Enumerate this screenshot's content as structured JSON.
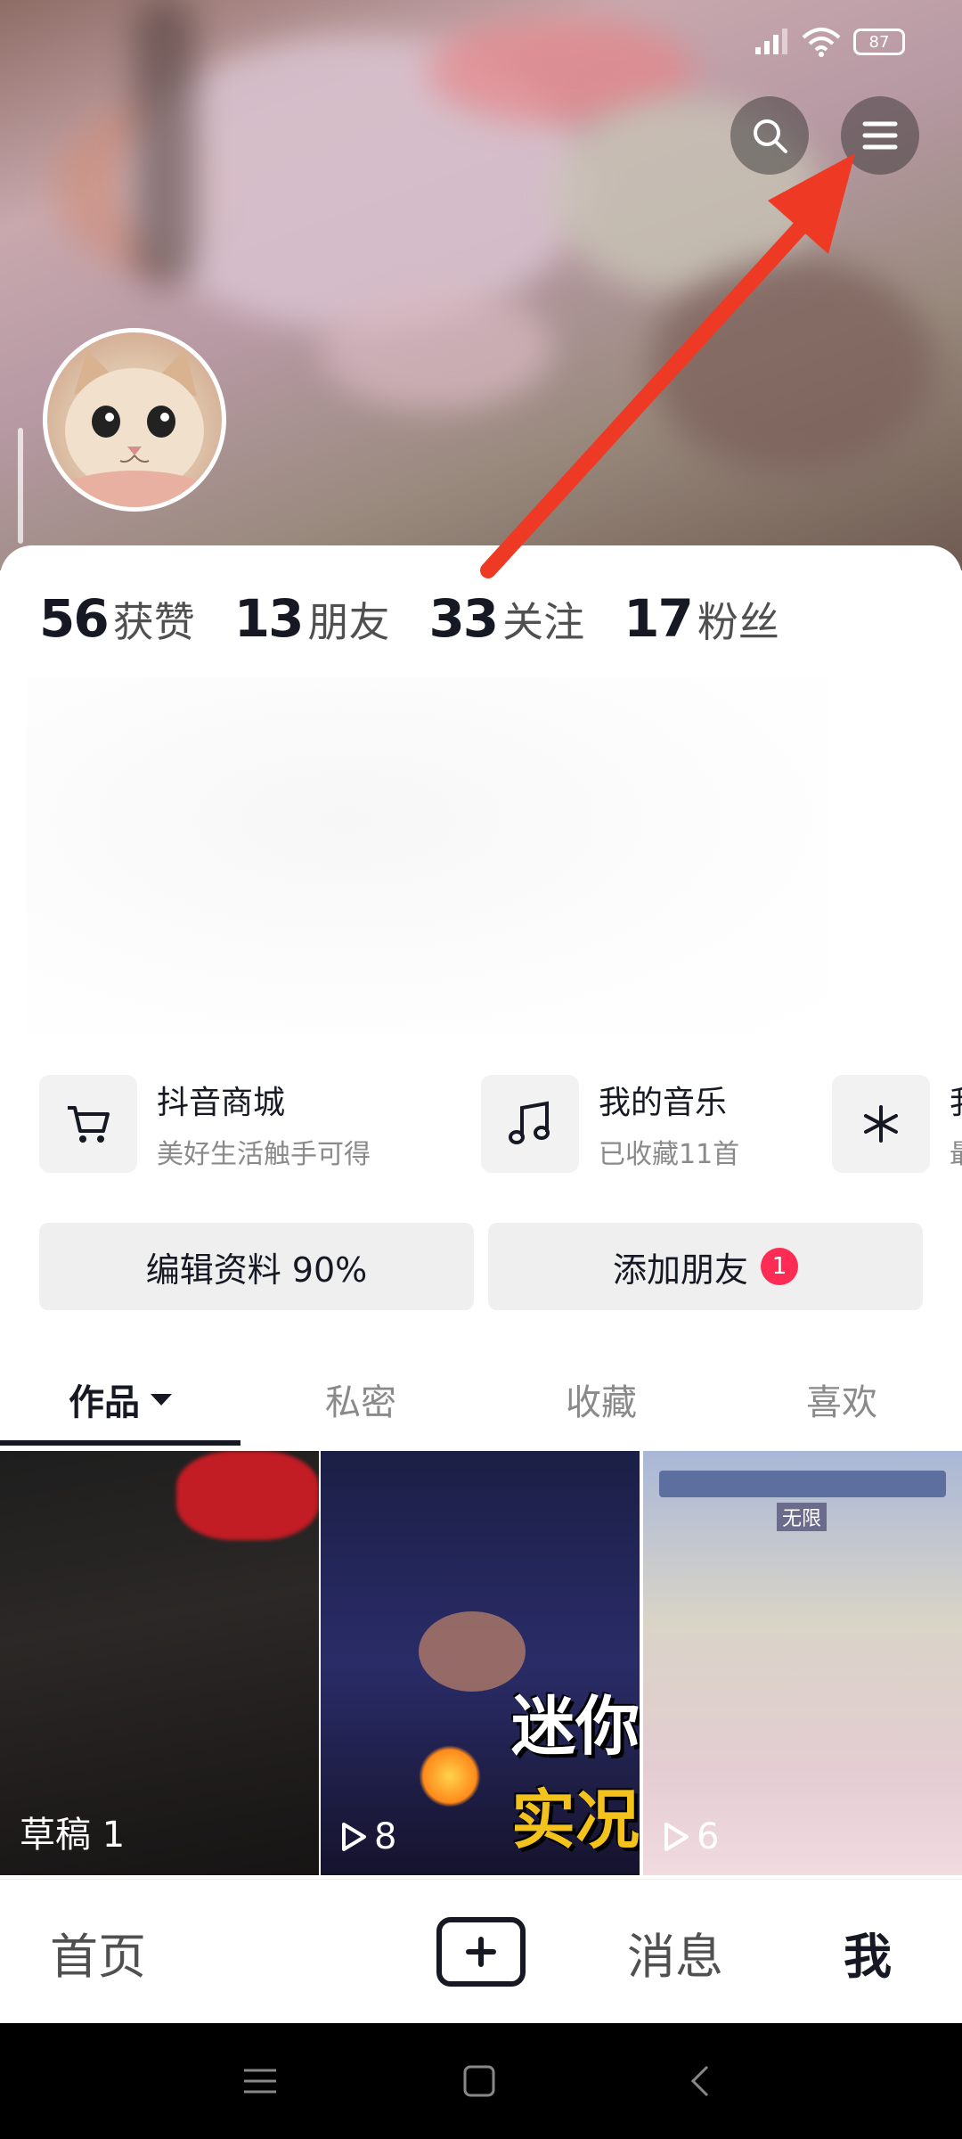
{
  "status_bar": {
    "battery": "87"
  },
  "profile": {
    "stats": [
      {
        "value": "56",
        "label": "获赞"
      },
      {
        "value": "13",
        "label": "朋友"
      },
      {
        "value": "33",
        "label": "关注"
      },
      {
        "value": "17",
        "label": "粉丝"
      }
    ]
  },
  "services": [
    {
      "title": "抖音商城",
      "subtitle": "美好生活触手可得",
      "icon": "cart-icon"
    },
    {
      "title": "我的音乐",
      "subtitle": "已收藏11首",
      "icon": "music-note-icon"
    },
    {
      "title": "我",
      "subtitle": "最",
      "icon": "sparkle-icon"
    }
  ],
  "actions": {
    "edit_profile": "编辑资料 90%",
    "add_friend": "添加朋友",
    "add_friend_badge": "1"
  },
  "tabs": [
    {
      "label": "作品",
      "active": true
    },
    {
      "label": "私密"
    },
    {
      "label": "收藏"
    },
    {
      "label": "喜欢"
    }
  ],
  "videos": [
    {
      "label": "草稿 1"
    },
    {
      "label": "8",
      "overlay_line1": "迷你",
      "overlay_line2": "实况",
      "play_icon": "play-icon"
    },
    {
      "label": "6",
      "game_chip": "无限",
      "play_icon": "play-icon"
    }
  ],
  "bottom_nav": {
    "home": "首页",
    "messages": "消息",
    "me": "我",
    "create_icon": "plus-icon"
  },
  "colors": {
    "accent": "#fe2c55",
    "annotation_arrow": "#ee3a24",
    "text_primary": "#161823"
  }
}
